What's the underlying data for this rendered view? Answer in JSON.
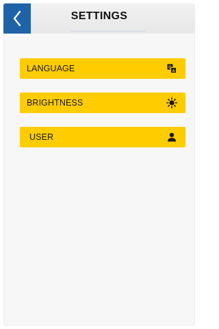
{
  "header": {
    "title": "SETTINGS",
    "back_icon": "chevron-left-icon"
  },
  "menu": {
    "items": [
      {
        "label": "LANGUAGE",
        "icon": "translate-icon"
      },
      {
        "label": "BRIGHTNESS",
        "icon": "sun-icon"
      },
      {
        "label": "USER",
        "icon": "user-icon"
      }
    ]
  },
  "colors": {
    "accent": "#ffcc00",
    "back_button": "#1e63a8",
    "text": "#1a1a1a"
  }
}
